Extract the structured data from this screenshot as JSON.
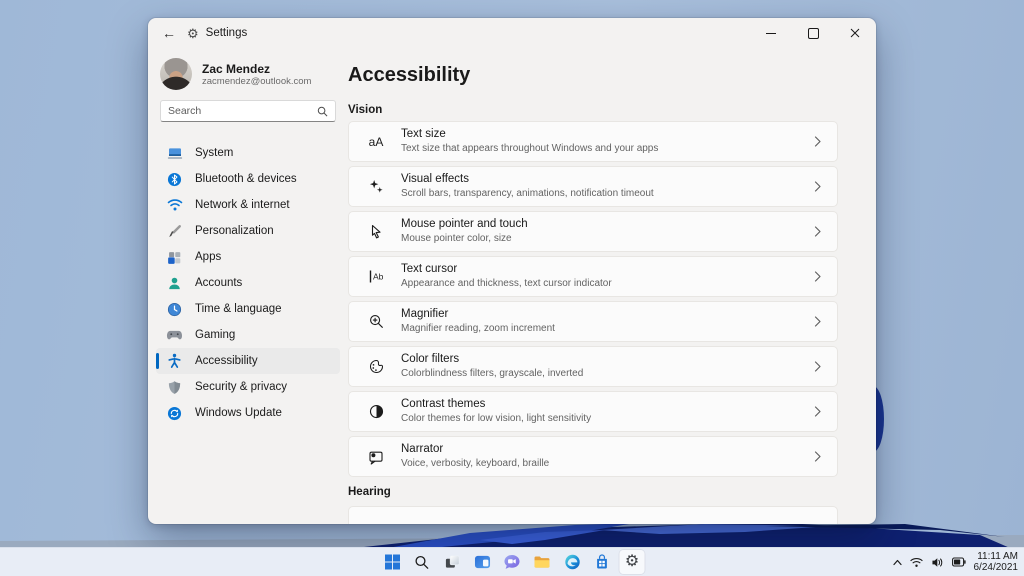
{
  "window": {
    "title": "Settings",
    "back_glyph": "←",
    "gear_glyph": "⚙"
  },
  "profile": {
    "name": "Zac Mendez",
    "email": "zacmendez@outlook.com"
  },
  "search": {
    "placeholder": "Search"
  },
  "sidebar": {
    "items": [
      {
        "label": "System",
        "icon": "system-icon"
      },
      {
        "label": "Bluetooth & devices",
        "icon": "bluetooth-icon"
      },
      {
        "label": "Network & internet",
        "icon": "network-icon"
      },
      {
        "label": "Personalization",
        "icon": "personalization-icon"
      },
      {
        "label": "Apps",
        "icon": "apps-icon"
      },
      {
        "label": "Accounts",
        "icon": "accounts-icon"
      },
      {
        "label": "Time & language",
        "icon": "time-language-icon"
      },
      {
        "label": "Gaming",
        "icon": "gaming-icon"
      },
      {
        "label": "Accessibility",
        "icon": "accessibility-icon",
        "selected": true
      },
      {
        "label": "Security & privacy",
        "icon": "security-icon"
      },
      {
        "label": "Windows Update",
        "icon": "windows-update-icon"
      }
    ]
  },
  "main": {
    "title": "Accessibility",
    "sections": [
      {
        "label": "Vision"
      },
      {
        "label": "Hearing"
      }
    ],
    "cards": [
      {
        "title": "Text size",
        "subtitle": "Text size that appears throughout Windows and your apps",
        "icon": "text-size-icon",
        "glyph": "aA"
      },
      {
        "title": "Visual effects",
        "subtitle": "Scroll bars, transparency, animations, notification timeout",
        "icon": "visual-effects-icon"
      },
      {
        "title": "Mouse pointer and touch",
        "subtitle": "Mouse pointer color, size",
        "icon": "mouse-pointer-icon"
      },
      {
        "title": "Text cursor",
        "subtitle": "Appearance and thickness, text cursor indicator",
        "icon": "text-cursor-icon"
      },
      {
        "title": "Magnifier",
        "subtitle": "Magnifier reading, zoom increment",
        "icon": "magnifier-icon"
      },
      {
        "title": "Color filters",
        "subtitle": "Colorblindness filters, grayscale, inverted",
        "icon": "color-filters-icon"
      },
      {
        "title": "Contrast themes",
        "subtitle": "Color themes for low vision, light sensitivity",
        "icon": "contrast-themes-icon"
      },
      {
        "title": "Narrator",
        "subtitle": "Voice, verbosity, keyboard, braille",
        "icon": "narrator-icon"
      }
    ]
  },
  "taskbar": {
    "gear_glyph": "⚙",
    "icons": [
      "start-icon",
      "search-icon",
      "task-view-icon",
      "widgets-icon",
      "chat-icon",
      "file-explorer-icon",
      "edge-icon",
      "store-icon",
      "settings-icon"
    ],
    "active_app": "settings"
  },
  "tray": {
    "icons": [
      "chevron-up-icon",
      "wifi-icon",
      "volume-icon",
      "battery-icon"
    ],
    "time": "11:11 AM",
    "date": "6/24/2021"
  },
  "colors": {
    "accent": "#0067c0",
    "window_bg": "#f3f2f1",
    "card_bg": "#fbfbfb",
    "selected_nav_bg": "#eaeaea",
    "taskbar_bg": "#e8edf6",
    "desktop_blue": "#a3bada",
    "bloom_navy": "#0e2070",
    "bloom_blue": "#2b50c8"
  }
}
